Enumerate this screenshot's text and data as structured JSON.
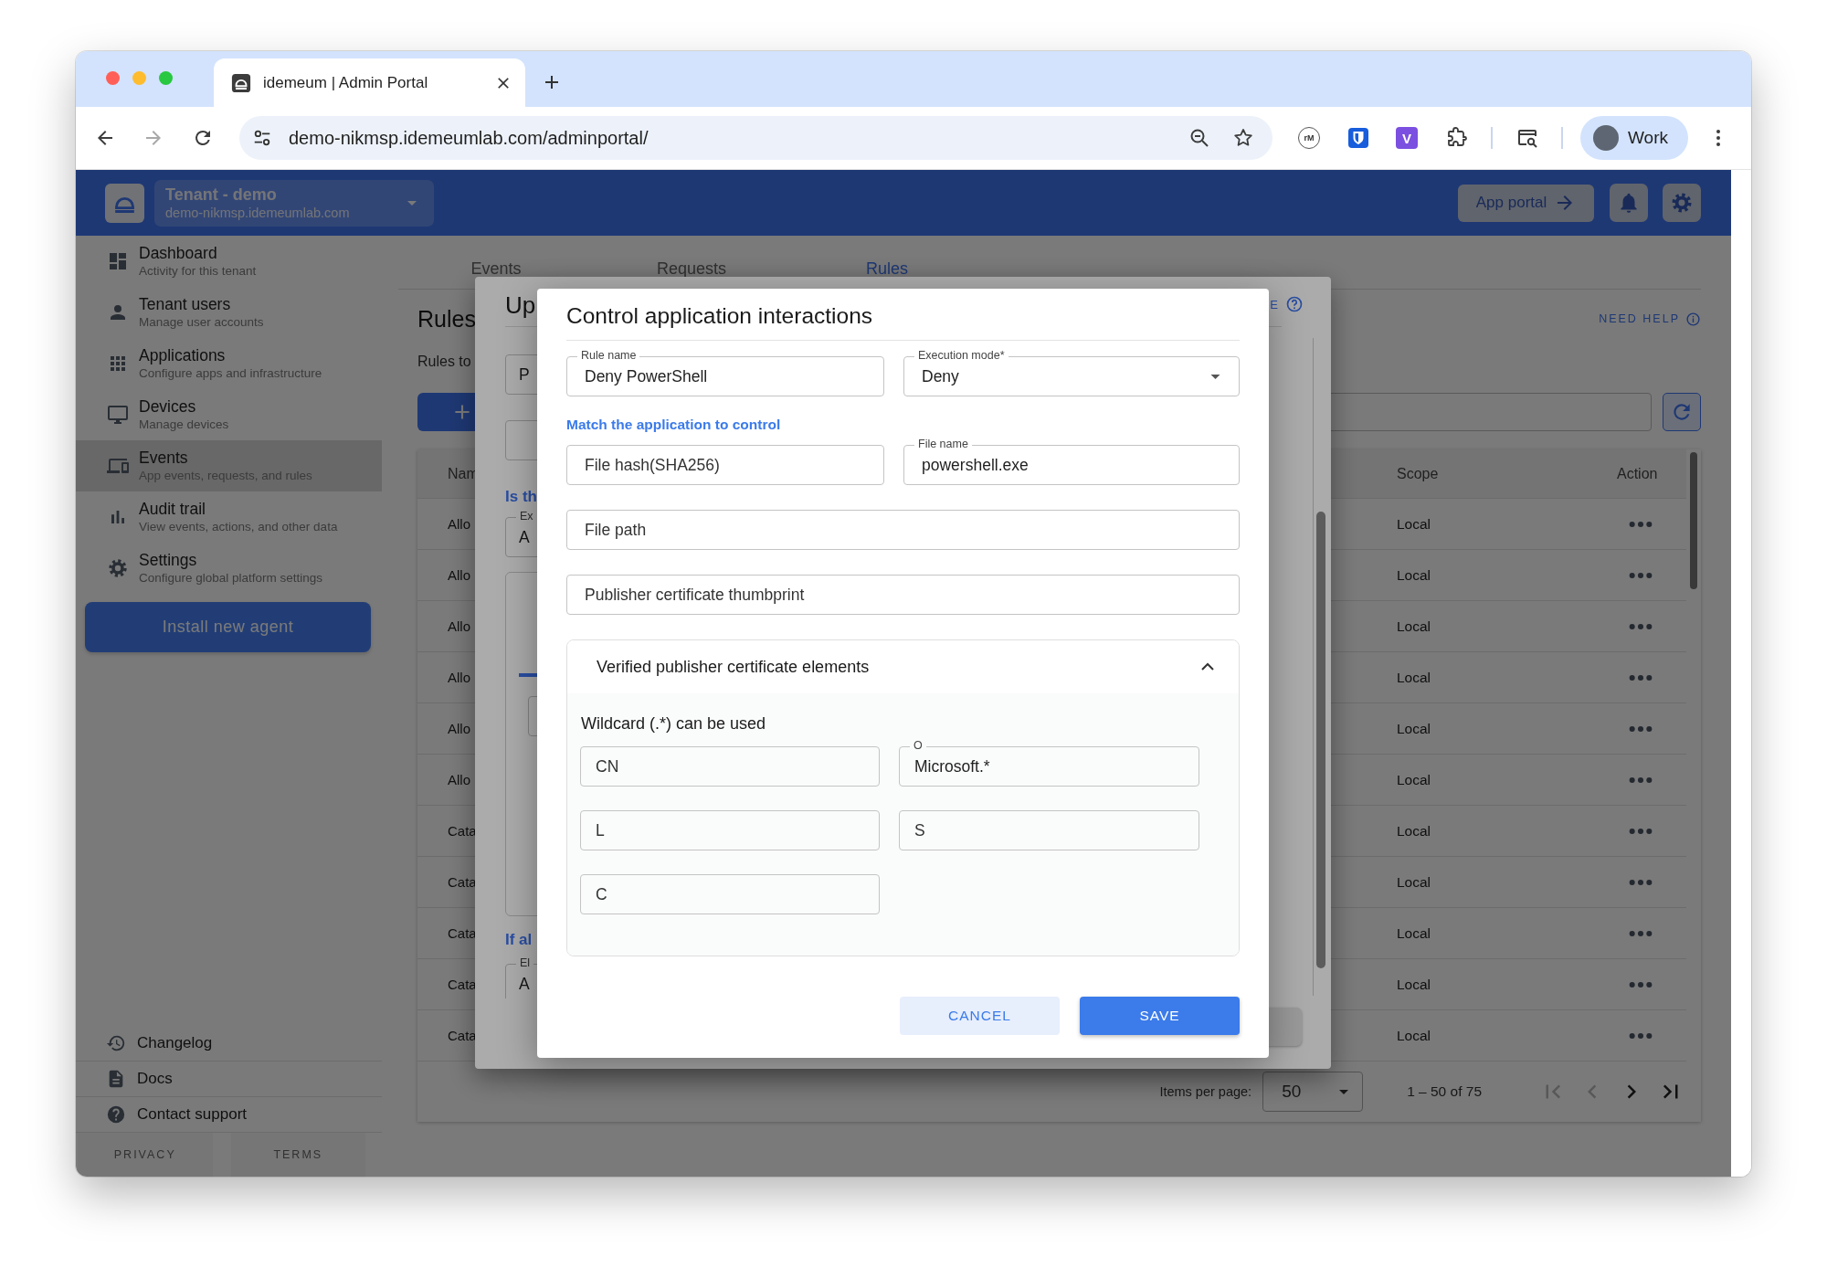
{
  "browser": {
    "tab_title": "idemeum | Admin Portal",
    "url": "demo-nikmsp.idemeumlab.com/adminportal/",
    "extensions": [
      {
        "text": "rM"
      },
      {
        "text": "V"
      }
    ],
    "profile": "Work"
  },
  "header": {
    "tenant_name": "Tenant - demo",
    "tenant_domain": "demo-nikmsp.idemeumlab.com",
    "app_portal": "App portal"
  },
  "sidebar": {
    "items": [
      {
        "kind": "dashboard",
        "title": "Dashboard",
        "subtitle": "Activity for this tenant",
        "selected": false
      },
      {
        "kind": "users",
        "title": "Tenant users",
        "subtitle": "Manage user accounts",
        "selected": false
      },
      {
        "kind": "applications",
        "title": "Applications",
        "subtitle": "Configure apps and infrastructure",
        "selected": false
      },
      {
        "kind": "devices",
        "title": "Devices",
        "subtitle": "Manage devices",
        "selected": false
      },
      {
        "kind": "events",
        "title": "Events",
        "subtitle": "App events, requests, and rules",
        "selected": true
      },
      {
        "kind": "audit",
        "title": "Audit trail",
        "subtitle": "View events, actions, and other data",
        "selected": false
      },
      {
        "kind": "settings",
        "title": "Settings",
        "subtitle": "Configure global platform settings",
        "selected": false
      }
    ],
    "install_button": "Install new agent",
    "footer_links": [
      {
        "kind": "changelog",
        "label": "Changelog"
      },
      {
        "kind": "docs",
        "label": "Docs"
      },
      {
        "kind": "support",
        "label": "Contact support"
      }
    ],
    "legal_links": [
      "PRIVACY",
      "TERMS"
    ]
  },
  "page": {
    "tabs": [
      {
        "label": "Events",
        "selected": false
      },
      {
        "label": "Requests",
        "selected": false
      },
      {
        "label": "Rules",
        "selected": true
      }
    ],
    "title": "Rules",
    "need_help": "NEED HELP",
    "subtitle": "Rules to",
    "table": {
      "columns": [
        "Nam",
        "Scope",
        "Action"
      ],
      "rows": [
        {
          "name": "Allo",
          "scope": "Local"
        },
        {
          "name": "Allo",
          "scope": "Local"
        },
        {
          "name": "Allo",
          "scope": "Local"
        },
        {
          "name": "Allo",
          "scope": "Local"
        },
        {
          "name": "Allo",
          "scope": "Local"
        },
        {
          "name": "Allo",
          "scope": "Local"
        },
        {
          "name": "Cata",
          "scope": "Local"
        },
        {
          "name": "Cata",
          "scope": "Local"
        },
        {
          "name": "Cata",
          "scope": "Local"
        },
        {
          "name": "Cata",
          "scope": "Local"
        },
        {
          "name": "Cata",
          "scope": "Local"
        }
      ]
    },
    "pagination": {
      "label": "Items per page:",
      "page_size": "50",
      "range": "1 – 50 of 75",
      "nav": [
        {
          "kind": "first",
          "disabled": true
        },
        {
          "kind": "prev",
          "disabled": true
        },
        {
          "kind": "next",
          "disabled": false
        },
        {
          "kind": "last",
          "disabled": false
        }
      ]
    }
  },
  "back_dialog": {
    "title": "Up",
    "corner_text": "E",
    "field_1": {
      "kind": "text",
      "value": "P"
    },
    "note_1": "Is th",
    "field_2": {
      "kind": "text",
      "label": "Ex",
      "value": "A"
    },
    "note_2": "If al",
    "field_3": {
      "kind": "text",
      "label": "El",
      "value": "A"
    }
  },
  "dialog": {
    "title": "Control application interactions",
    "top_fields": [
      {
        "kind": "text",
        "label": "Rule name",
        "value": "Deny PowerShell"
      },
      {
        "kind": "select",
        "label": "Execution mode*",
        "value": "Deny"
      }
    ],
    "match_heading": "Match the application to control",
    "match_rows": [
      [
        {
          "kind": "text",
          "placeholder": "File hash(SHA256)"
        },
        {
          "kind": "text",
          "label": "File name",
          "value": "powershell.exe"
        }
      ],
      [
        {
          "kind": "text",
          "placeholder": "File path"
        }
      ],
      [
        {
          "kind": "text",
          "placeholder": "Publisher certificate thumbprint"
        }
      ]
    ],
    "panel": {
      "title": "Verified publisher certificate elements",
      "expanded": true,
      "hint": "Wildcard (.*) can be used",
      "rows": [
        [
          {
            "kind": "text",
            "placeholder": "CN"
          },
          {
            "kind": "text",
            "label": "O",
            "value": "Microsoft.*"
          }
        ],
        [
          {
            "kind": "text",
            "placeholder": "L"
          },
          {
            "kind": "text",
            "placeholder": "S"
          }
        ],
        [
          {
            "kind": "text",
            "placeholder": "C"
          }
        ]
      ]
    },
    "buttons": [
      {
        "kind": "secondary",
        "label": "CANCEL"
      },
      {
        "kind": "primary",
        "label": "SAVE"
      }
    ]
  }
}
